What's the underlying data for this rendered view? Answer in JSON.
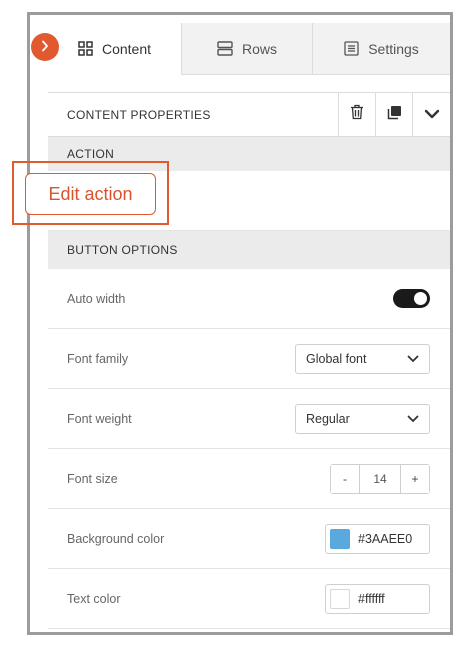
{
  "tabs": [
    {
      "label": "Content",
      "icon": "grid-icon",
      "active": true
    },
    {
      "label": "Rows",
      "icon": "rows-icon",
      "active": false
    },
    {
      "label": "Settings",
      "icon": "settings-list-icon",
      "active": false
    }
  ],
  "content_properties": {
    "title": "CONTENT PROPERTIES",
    "actions": [
      "trash-icon",
      "duplicate-icon",
      "chevron-down-icon"
    ]
  },
  "action_section": {
    "title": "ACTION",
    "edit_button_label": "Edit action"
  },
  "button_options": {
    "title": "BUTTON OPTIONS",
    "auto_width": {
      "label": "Auto width",
      "enabled": true
    },
    "font_family": {
      "label": "Font family",
      "value": "Global font"
    },
    "font_weight": {
      "label": "Font weight",
      "value": "Regular"
    },
    "font_size": {
      "label": "Font size",
      "value": "14",
      "decrement": "-",
      "increment": "+"
    },
    "background_color": {
      "label": "Background color",
      "value": "#3AAEE0",
      "swatch": "#5aa9dc"
    },
    "text_color": {
      "label": "Text color",
      "value": "#ffffff",
      "swatch": "#ffffff"
    }
  },
  "colors": {
    "accent": "#e0592f",
    "toggle_on": "#1a1a1a"
  }
}
